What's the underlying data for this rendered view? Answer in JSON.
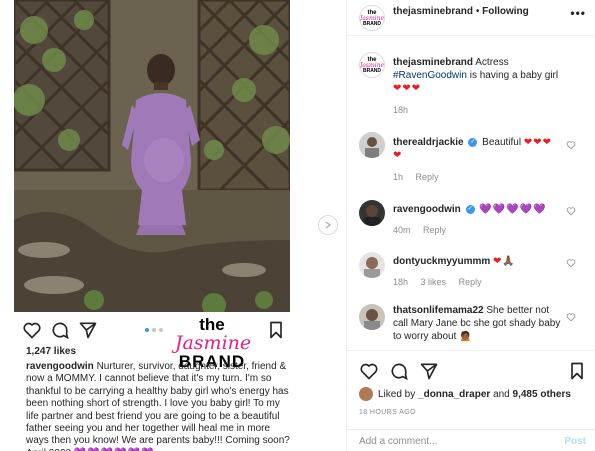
{
  "post": {
    "likes_text": "1,247 likes",
    "caption_user": "ravengoodwin",
    "caption_text": "Nurturer, survivor, daughter, sister, friend & now a MOMMY. I cannot believe that it's my turn. I'm so thankful to be carrying a healthy baby girl who's energy has been nothing short of strength. I love you baby girl! To my life partner and best friend you are going to be a beautiful father seeing you and her together will heal me in more ways then you know! We are parents baby!!! Coming soon? April 2020",
    "caption_hearts": "💜💜💜💜💜💜",
    "watermark": {
      "line1": "the",
      "line2": "Jasmine",
      "line3": "BRAND"
    }
  },
  "header": {
    "username": "thejasminebrand",
    "separator": "•",
    "follow_label": "Following",
    "more_label": "•••",
    "avatar": {
      "line1": "the",
      "line2": "Jasmine",
      "line3": "BRAND"
    }
  },
  "comments": [
    {
      "user": "thejasminebrand",
      "text_before": "Actress",
      "hashtag": "#RavenGoodwin",
      "text_after": "is having a baby girl",
      "emoji": "❤❤❤",
      "time": "18h",
      "likes": "",
      "reply": ""
    },
    {
      "user": "therealdrjackie",
      "verified": true,
      "text": "Beautiful",
      "emoji": "❤❤❤❤",
      "time": "1h",
      "likes": "",
      "reply": "Reply"
    },
    {
      "user": "ravengoodwin",
      "verified": true,
      "text": "",
      "emoji": "💜💜💜💜💜",
      "time": "40m",
      "likes": "",
      "reply": "Reply"
    },
    {
      "user": "dontyuckmyyummm",
      "text": "",
      "emoji": "❤🙏🏾",
      "time": "18h",
      "likes": "3 likes",
      "reply": "Reply"
    },
    {
      "user": "thatsonlifemama22",
      "text": "She better not call Mary Jane bc she got shady baby to worry about",
      "emoji": "🙍🏾",
      "time": "",
      "likes": "",
      "reply": ""
    }
  ],
  "footer": {
    "liked_prefix": "Liked by",
    "liked_user": "_donna_draper",
    "liked_suffix": "and",
    "liked_count": "9,485 others",
    "time_ago": "18 HOURS AGO",
    "add_comment_placeholder": "Add a comment...",
    "post_label": "Post"
  },
  "colors": {
    "link_blue": "#3897f0",
    "heart_red": "#ed1c24",
    "brand_pink": "#e0208a",
    "post_disabled": "#b2dffc"
  },
  "icons": [
    "heart-icon",
    "comment-icon",
    "share-icon",
    "bookmark-icon",
    "next-arrow-icon",
    "more-icon",
    "verified-icon"
  ]
}
